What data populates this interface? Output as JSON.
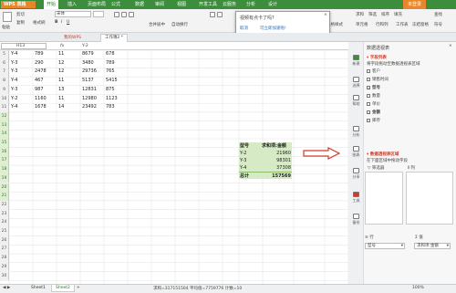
{
  "app": {
    "name": "WPS 表格"
  },
  "menu": [
    "开始",
    "插入",
    "页面布局",
    "公式",
    "数据",
    "审阅",
    "视图",
    "开发工具",
    "云服务",
    "分析",
    "设计"
  ],
  "menu_active": "开始",
  "user": "未登录",
  "toolbar": {
    "paste": "粘贴",
    "cut": "剪切",
    "copy": "复制",
    "format_painter": "格式刷",
    "font": "宋体",
    "merge": "合并居中",
    "wrap": "自动换行",
    "conditional": "条件格式",
    "table_style": "表格样式",
    "sum": "求和",
    "filter": "筛选",
    "sort": "排序",
    "fill": "填充",
    "cells": "单元格",
    "rows_cols": "行和列",
    "worksheet": "工作表",
    "freeze": "冻结窗格",
    "find": "查找",
    "symbol": "符号"
  },
  "popup": {
    "title": "视频有点卡了吗?",
    "option1": "取消",
    "option2": "可立即加速啦!"
  },
  "file_tabs": [
    "我的WPS",
    "工作簿2 *"
  ],
  "formula_bar": {
    "cell_ref": "H13",
    "fx": "fx",
    "value": "Y-2"
  },
  "rows": [
    {
      "n": "5",
      "a": "Y-4",
      "b": "789",
      "c": "11",
      "d": "8679",
      "e": "678"
    },
    {
      "n": "6",
      "a": "Y-3",
      "b": "290",
      "c": "12",
      "d": "3480",
      "e": "789"
    },
    {
      "n": "7",
      "a": "Y-3",
      "b": "2478",
      "c": "12",
      "d": "29736",
      "e": "765"
    },
    {
      "n": "8",
      "a": "Y-4",
      "b": "467",
      "c": "11",
      "d": "5137",
      "e": "5415"
    },
    {
      "n": "9",
      "a": "Y-3",
      "b": "987",
      "c": "13",
      "d": "12831",
      "e": "875"
    },
    {
      "n": "10",
      "a": "Y-2",
      "b": "1160",
      "c": "11",
      "d": "12980",
      "e": "1123"
    },
    {
      "n": "11",
      "a": "Y-4",
      "b": "1678",
      "c": "14",
      "d": "23492",
      "e": "783"
    }
  ],
  "more_rows": [
    "12",
    "13",
    "14",
    "15",
    "16",
    "17",
    "18",
    "19",
    "20",
    "21",
    "22",
    "23",
    "24",
    "25",
    "26",
    "27",
    "28",
    "29",
    "30",
    "31",
    "32",
    "33",
    "34",
    "35"
  ],
  "pivot": {
    "headers": [
      "型号",
      "求和项:金额"
    ],
    "items": [
      {
        "label": "Y-2",
        "value": "21960"
      },
      {
        "label": "Y-3",
        "value": "98301"
      },
      {
        "label": "Y-4",
        "value": "37308"
      }
    ],
    "total_label": "总计",
    "total_value": "157569"
  },
  "panel": {
    "title": "数据透视表",
    "field_list": "字段列表",
    "drag_hint": "将字段拖动至数据透视表区域",
    "fields": [
      {
        "label": "客户",
        "checked": false
      },
      {
        "label": "销售时间",
        "checked": false
      },
      {
        "label": "型号",
        "checked": true
      },
      {
        "label": "数量",
        "checked": false
      },
      {
        "label": "单价",
        "checked": false
      },
      {
        "label": "金额",
        "checked": true
      },
      {
        "label": "库存",
        "checked": false
      }
    ],
    "areas_title": "数据透视表区域",
    "areas_hint": "在下面区域中拖动字段",
    "filter_label": "筛选器",
    "col_label": "列",
    "row_label": "行",
    "value_label": "值",
    "row_field": "型号",
    "value_field": "求和项:金额"
  },
  "sidebar": [
    "新建",
    "选择",
    "帮助",
    "分析",
    "图表",
    "分享",
    "工具",
    "备份"
  ],
  "sheets": [
    "Sheet1",
    "Sheet2"
  ],
  "status_text": "求和=317151504  平均值=7759776  计数=10",
  "zoom": "100%",
  "colors": {
    "green": "#3c8d3c",
    "orange": "#e8872a",
    "red": "#d23b2a",
    "pivot_fill": "#d6ebc5"
  }
}
